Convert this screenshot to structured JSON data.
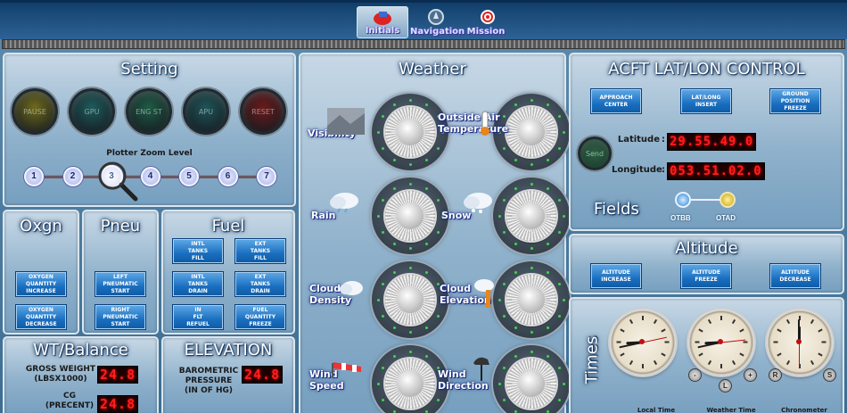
{
  "tabs": [
    {
      "label": "Initials",
      "active": true
    },
    {
      "label": "Navigation",
      "active": false
    },
    {
      "label": "Mission",
      "active": false
    }
  ],
  "setting": {
    "title": "Setting",
    "buttons": [
      {
        "label": "PAUSE",
        "color": "#6e6a1c"
      },
      {
        "label": "GPU",
        "color": "#1e5b5c"
      },
      {
        "label": "ENG ST",
        "color": "#1e5b45"
      },
      {
        "label": "APU",
        "color": "#1e5458"
      },
      {
        "label": "RESET",
        "color": "#6a1a1a"
      }
    ],
    "zoom_label": "Plotter Zoom Level",
    "zoom_levels": [
      "1",
      "2",
      "3",
      "4",
      "5",
      "6",
      "7"
    ],
    "zoom_selected": 3
  },
  "oxgn": {
    "title": "Oxgn",
    "buttons": [
      "OXYGEN\nQUANTITY\nINCREASE",
      "OXYGEN\nQUANTITY\nDECREASE"
    ]
  },
  "pneu": {
    "title": "Pneu",
    "buttons": [
      "LEFT\nPNEUMATIC\nSTART",
      "RIGHT\nPNEUMATIC\nSTART"
    ]
  },
  "fuel": {
    "title": "Fuel",
    "buttons": [
      "INTL\nTANKS\nFILL",
      "EXT\nTANKS\nFILL",
      "INTL\nTANKS\nDRAIN",
      "EXT\nTANKS\nDRAIN",
      "IN\nFLT\nREFUEL",
      "FUEL\nQUANTITY\nFREEZE"
    ]
  },
  "wt_balance": {
    "title": "WT/Balance",
    "gross_label": "GROSS WEIGHT\n(LBSX1000)",
    "gross_value": "24.8",
    "cg_label": "CG\n(PRECENT)",
    "cg_value": "24.8"
  },
  "elevation": {
    "title": "ELEVATION",
    "baro_label": "BAROMETRIC\nPRESSURE\n(IN OF HG)",
    "baro_value": "24.8"
  },
  "weather": {
    "title": "Weather",
    "dials": [
      {
        "label": "Visibility"
      },
      {
        "label": "Outside Air\nTemperature"
      },
      {
        "label": "Rain"
      },
      {
        "label": "Snow"
      },
      {
        "label": "Cloud\nDensity"
      },
      {
        "label": "Cloud\nElevation"
      },
      {
        "label": "Wind\nSpeed"
      },
      {
        "label": "Wind\nDirection"
      }
    ]
  },
  "acft": {
    "title": "ACFT LAT/LON CONTROL",
    "buttons": [
      "APPROACH\nCENTER",
      "LAT/LONG\nINSERT",
      "GROUND\nPOSITION\nFREEZE"
    ],
    "send_label": "Send",
    "latitude_label": "Latitude",
    "latitude_value": "29.55.49.0",
    "longitude_label": "Longitude",
    "longitude_value": "053.51.02.0",
    "fields_title": "Fields",
    "fields": [
      "OTBB",
      "OTAD"
    ]
  },
  "altitude": {
    "title": "Altitude",
    "buttons": [
      "ALTITUDE\nINCREASE",
      "ALTITUDE\nFREEZE",
      "ALTITUDE\nDECREASE"
    ]
  },
  "times": {
    "title": "Times",
    "clocks": [
      {
        "label": "Local Time",
        "hour": 8.2,
        "minute": 43,
        "second": 13
      },
      {
        "label": "Weather Time",
        "hour": 8.2,
        "minute": 43,
        "second": 14
      },
      {
        "label": "Chronometer",
        "hour": 0,
        "minute": 0,
        "second": 30
      }
    ],
    "weather_buttons": [
      "-",
      "L",
      "+"
    ],
    "chrono_buttons": [
      "R",
      "S"
    ]
  }
}
